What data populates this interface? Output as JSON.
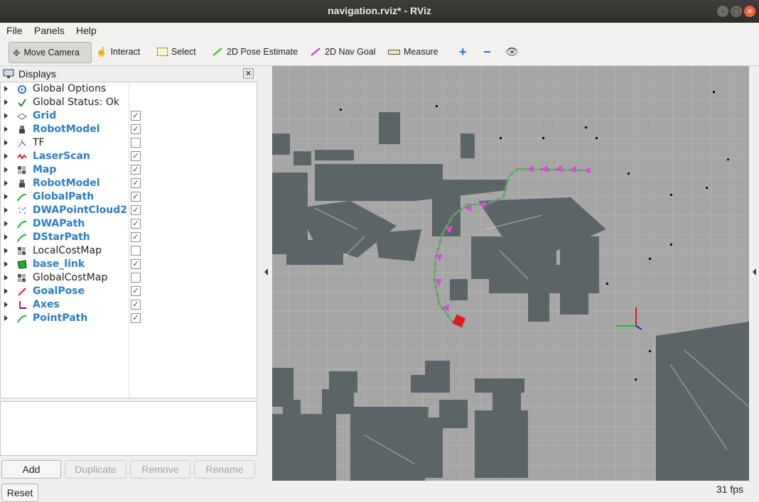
{
  "window": {
    "title": "navigation.rviz* - RViz"
  },
  "menu": [
    "File",
    "Panels",
    "Help"
  ],
  "toolbar": {
    "tools": [
      {
        "label": "Move Camera",
        "icon": "move-camera-icon"
      },
      {
        "label": "Interact",
        "icon": "hand-icon"
      },
      {
        "label": "Select",
        "icon": "select-box-icon"
      },
      {
        "label": "2D Pose Estimate",
        "icon": "green-arrow-icon"
      },
      {
        "label": "2D Nav Goal",
        "icon": "magenta-arrow-icon"
      },
      {
        "label": "Measure",
        "icon": "ruler-icon"
      }
    ]
  },
  "displays": {
    "title": "Displays",
    "items": [
      {
        "label": "Global Options",
        "checked": null,
        "icon": "gear-icon"
      },
      {
        "label": "Global Status: Ok",
        "checked": null,
        "icon": "check-icon"
      },
      {
        "label": "Grid",
        "checked": true,
        "icon": "grid-icon"
      },
      {
        "label": "RobotModel",
        "checked": true,
        "icon": "robot-icon"
      },
      {
        "label": "TF",
        "checked": false,
        "icon": "tf-icon"
      },
      {
        "label": "LaserScan",
        "checked": true,
        "icon": "laser-icon"
      },
      {
        "label": "Map",
        "checked": true,
        "icon": "map-icon"
      },
      {
        "label": "RobotModel",
        "checked": true,
        "icon": "robot-icon"
      },
      {
        "label": "GlobalPath",
        "checked": true,
        "icon": "path-icon"
      },
      {
        "label": "DWAPointCloud2",
        "checked": true,
        "icon": "pointcloud-icon"
      },
      {
        "label": "DWAPath",
        "checked": true,
        "icon": "path-icon"
      },
      {
        "label": "DStarPath",
        "checked": true,
        "icon": "path-icon"
      },
      {
        "label": "LocalCostMap",
        "checked": false,
        "icon": "map-icon"
      },
      {
        "label": "base_link",
        "checked": true,
        "icon": "polygon-icon"
      },
      {
        "label": "GlobalCostMap",
        "checked": false,
        "icon": "map-icon"
      },
      {
        "label": "GoalPose",
        "checked": true,
        "icon": "pose-icon"
      },
      {
        "label": "Axes",
        "checked": true,
        "icon": "axes-icon"
      },
      {
        "label": "PointPath",
        "checked": true,
        "icon": "path-icon"
      }
    ]
  },
  "buttons": {
    "add": "Add",
    "duplicate": "Duplicate",
    "remove": "Remove",
    "rename": "Rename",
    "reset": "Reset"
  },
  "status": {
    "fps": "31 fps"
  },
  "colors": {
    "obstacle": "#5b6567",
    "free": "#a6a6a6",
    "path_arrow": "#d24fd6",
    "path_line": "#2ecc2e",
    "robot": "#e01b1b"
  }
}
